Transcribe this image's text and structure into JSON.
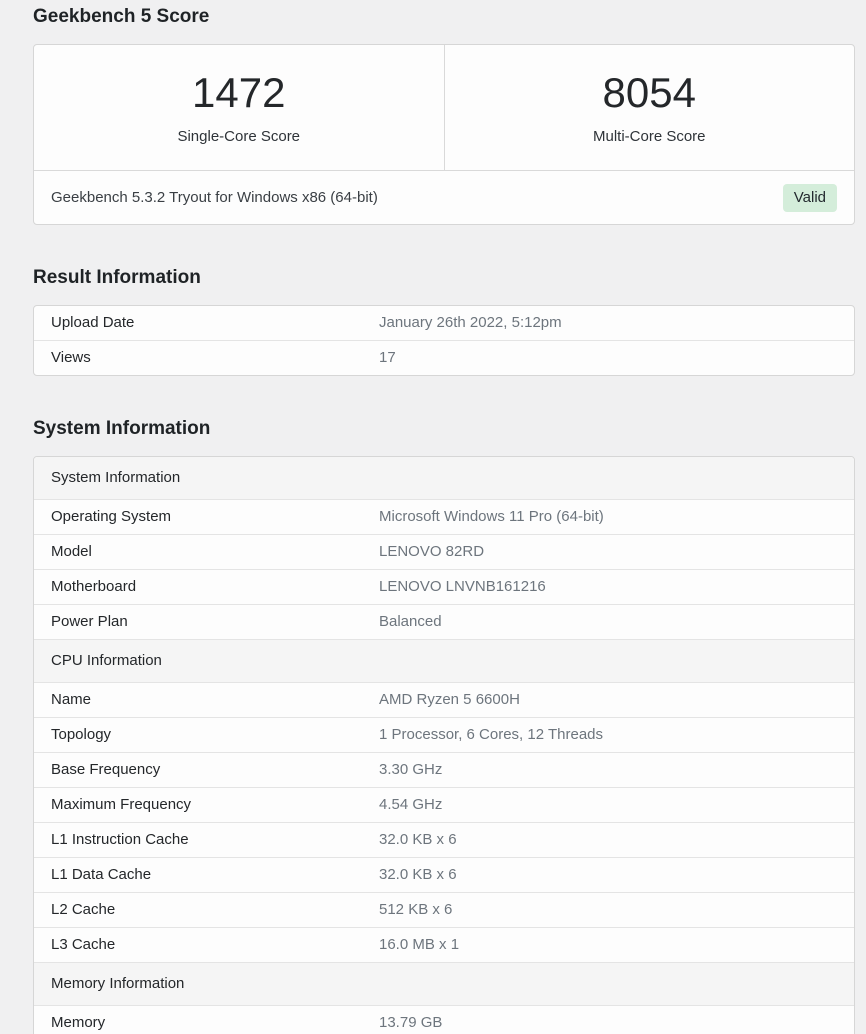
{
  "page_title": "Geekbench 5 Score",
  "score_card": {
    "scores": [
      {
        "value": "1472",
        "label": "Single-Core Score"
      },
      {
        "value": "8054",
        "label": "Multi-Core Score"
      }
    ],
    "footer_text": "Geekbench 5.3.2 Tryout for Windows x86 (64-bit)",
    "badge_label": "Valid",
    "badge_color": "#d4edda"
  },
  "result_information": {
    "title": "Result Information",
    "rows": [
      {
        "label": "Upload Date",
        "value": "January 26th 2022, 5:12pm"
      },
      {
        "label": "Views",
        "value": "17"
      }
    ]
  },
  "system_information": {
    "title": "System Information",
    "sections": [
      {
        "header": "System Information",
        "rows": [
          {
            "label": "Operating System",
            "value": "Microsoft Windows 11 Pro (64-bit)"
          },
          {
            "label": "Model",
            "value": "LENOVO 82RD"
          },
          {
            "label": "Motherboard",
            "value": "LENOVO LNVNB161216"
          },
          {
            "label": "Power Plan",
            "value": "Balanced"
          }
        ]
      },
      {
        "header": "CPU Information",
        "rows": [
          {
            "label": "Name",
            "value": "AMD Ryzen 5 6600H"
          },
          {
            "label": "Topology",
            "value": "1 Processor, 6 Cores, 12 Threads"
          },
          {
            "label": "Base Frequency",
            "value": "3.30 GHz"
          },
          {
            "label": "Maximum Frequency",
            "value": "4.54 GHz"
          },
          {
            "label": "L1 Instruction Cache",
            "value": "32.0 KB x 6"
          },
          {
            "label": "L1 Data Cache",
            "value": "32.0 KB x 6"
          },
          {
            "label": "L2 Cache",
            "value": "512 KB x 6"
          },
          {
            "label": "L3 Cache",
            "value": "16.0 MB x 1"
          }
        ]
      },
      {
        "header": "Memory Information",
        "rows": [
          {
            "label": "Memory",
            "value": "13.79 GB"
          }
        ]
      }
    ]
  }
}
